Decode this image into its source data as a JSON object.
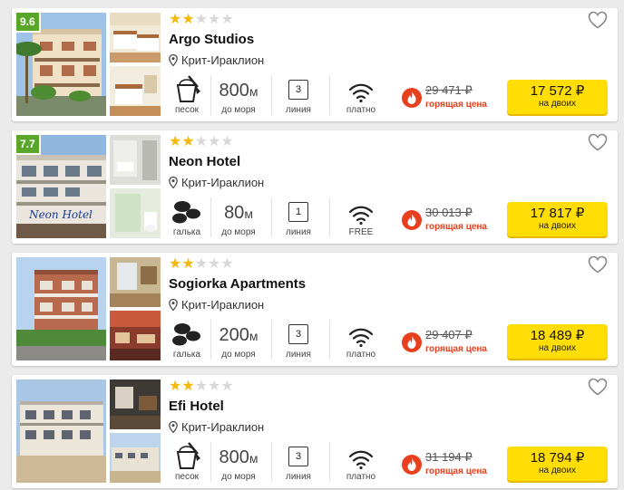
{
  "hotels": [
    {
      "rating": "9.6",
      "stars_filled": 2,
      "stars_total": 5,
      "name": "Argo Studios",
      "location": "Крит-Ираклион",
      "beach_label": "песок",
      "distance_value": "800",
      "distance_unit": "м",
      "distance_label": "до моря",
      "line_value": "3",
      "line_label": "линия",
      "wifi_label": "платно",
      "old_price": "29 471 ₽",
      "hot_label": "горящая цена",
      "price": "17 572 ₽",
      "price_sub": "на двоих"
    },
    {
      "rating": "7.7",
      "stars_filled": 2,
      "stars_total": 5,
      "name": "Neon Hotel",
      "location": "Крит-Ираклион",
      "beach_label": "галька",
      "distance_value": "80",
      "distance_unit": "м",
      "distance_label": "до моря",
      "line_value": "1",
      "line_label": "линия",
      "wifi_label": "FREE",
      "old_price": "30 013 ₽",
      "hot_label": "горящая цена",
      "price": "17 817 ₽",
      "price_sub": "на двоих",
      "sign_text": "Neon Hotel"
    },
    {
      "rating": "",
      "stars_filled": 2,
      "stars_total": 5,
      "name": "Sogiorka Apartments",
      "location": "Крит-Ираклион",
      "beach_label": "галька",
      "distance_value": "200",
      "distance_unit": "м",
      "distance_label": "до моря",
      "line_value": "3",
      "line_label": "линия",
      "wifi_label": "платно",
      "old_price": "29 407 ₽",
      "hot_label": "горящая цена",
      "price": "18 489 ₽",
      "price_sub": "на двоих"
    },
    {
      "rating": "",
      "stars_filled": 2,
      "stars_total": 5,
      "name": "Efi Hotel",
      "location": "Крит-Ираклион",
      "beach_label": "песок",
      "distance_value": "800",
      "distance_unit": "м",
      "distance_label": "до моря",
      "line_value": "3",
      "line_label": "линия",
      "wifi_label": "платно",
      "old_price": "31 194 ₽",
      "hot_label": "горящая цена",
      "price": "18 794 ₽",
      "price_sub": "на двоих"
    }
  ],
  "icons": {
    "location": "map-pin-icon",
    "beach_sand": "sand-bucket-icon",
    "beach_pebble": "pebble-icon",
    "wifi": "wifi-icon",
    "hot": "fire-icon",
    "favorite": "heart-icon"
  },
  "colors": {
    "rating_badge": "#5aa62a",
    "star_filled": "#f5b80b",
    "star_empty": "#d8d8d8",
    "hot_red": "#e8401e",
    "price_button": "#ffdd05"
  }
}
